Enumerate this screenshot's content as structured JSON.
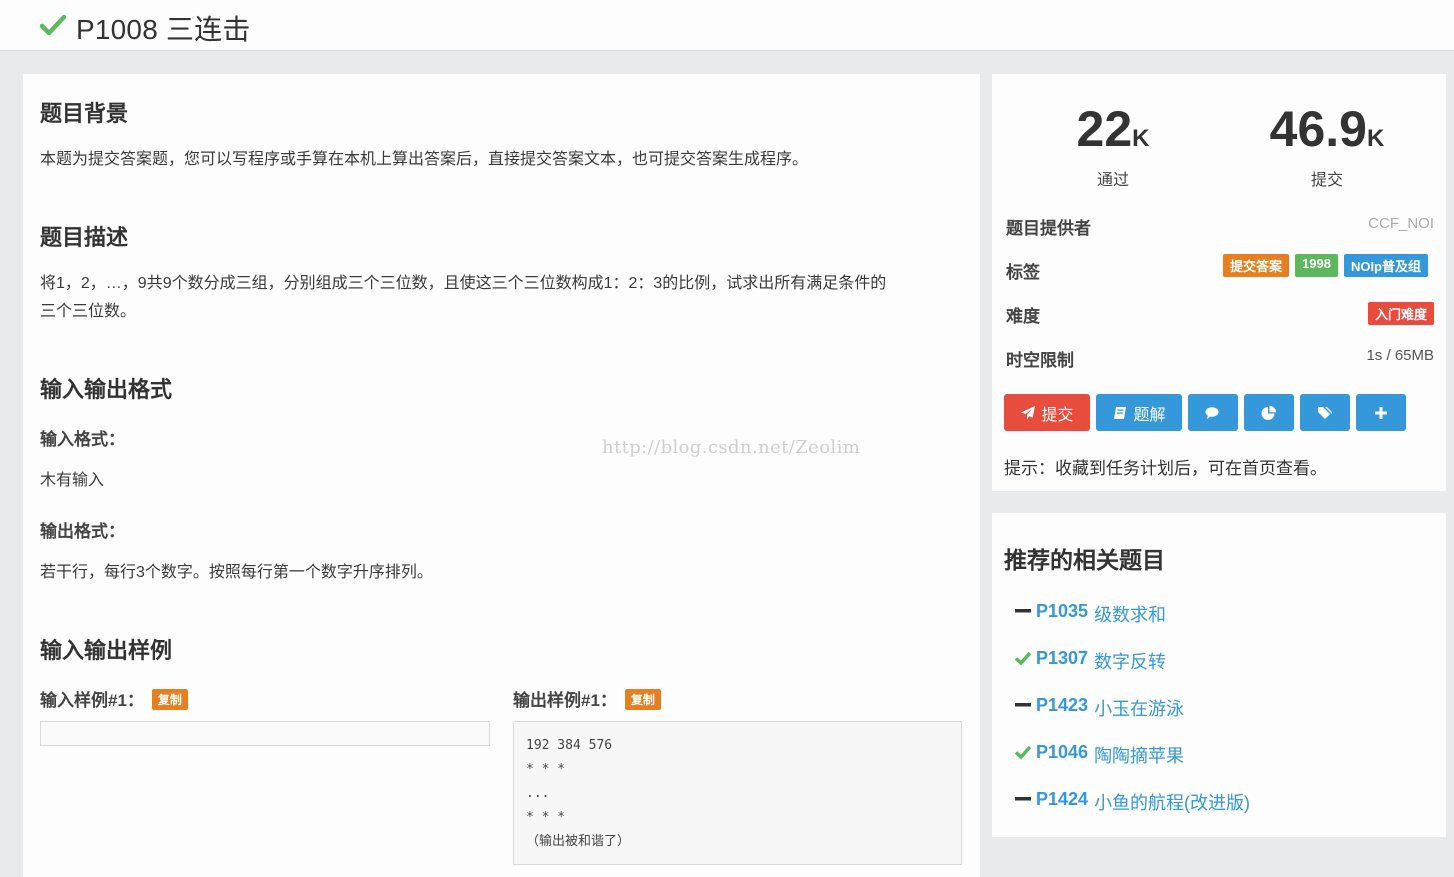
{
  "header": {
    "title": "P1008 三连击",
    "status_icon": "check-icon"
  },
  "main": {
    "background": {
      "heading": "题目背景",
      "text": "本题为提交答案题，您可以写程序或手算在本机上算出答案后，直接提交答案文本，也可提交答案生成程序。"
    },
    "description": {
      "heading": "题目描述",
      "line1": "将1，2，…，9共9个数分成三组，分别组成三个三位数，且使这三个三位数构成1：2：3的比例，试求出所有满足条件的",
      "line2": "三个三位数。"
    },
    "io_format": {
      "heading": "输入输出格式",
      "input_label": "输入格式：",
      "input_text": "木有输入",
      "output_label": "输出格式：",
      "output_text": "若干行，每行3个数字。按照每行第一个数字升序排列。"
    },
    "samples": {
      "heading": "输入输出样例",
      "input_label": "输入样例#1：",
      "output_label": "输出样例#1：",
      "copy_label": "复制",
      "input_value": "",
      "output_value": "192 384 576\n* * *\n...\n* * *\n（输出被和谐了）"
    },
    "watermark": "http://blog.csdn.net/Zeolim"
  },
  "stats": {
    "passed_value": "22",
    "passed_unit": "K",
    "passed_label": "通过",
    "submitted_value": "46.9",
    "submitted_unit": "K",
    "submitted_label": "提交",
    "provider_label": "题目提供者",
    "provider_value": "CCF_NOI",
    "tags_label": "标签",
    "tags": [
      {
        "text": "提交答案",
        "color": "#e67e22"
      },
      {
        "text": "1998",
        "color": "#5cb85c"
      },
      {
        "text": "NOIp普及组",
        "color": "#3498db"
      }
    ],
    "difficulty_label": "难度",
    "difficulty_value": "入门难度",
    "difficulty_color": "#e74c3c",
    "limits_label": "时空限制",
    "limits_value": "1s / 65MB",
    "buttons": {
      "submit_label": "提交",
      "solution_label": "题解",
      "submit_color": "#e74c3c",
      "action_color": "#3498db"
    },
    "tip": "提示：收藏到任务计划后，可在首页查看。"
  },
  "recommend": {
    "title": "推荐的相关题目",
    "items": [
      {
        "id": "P1035",
        "name": "级数求和",
        "status": "dash-icon"
      },
      {
        "id": "P1307",
        "name": "数字反转",
        "status": "check-icon"
      },
      {
        "id": "P1423",
        "name": "小玉在游泳",
        "status": "dash-icon"
      },
      {
        "id": "P1046",
        "name": "陶陶摘苹果",
        "status": "check-icon"
      },
      {
        "id": "P1424",
        "name": "小鱼的航程(改进版)",
        "status": "dash-icon"
      }
    ]
  }
}
